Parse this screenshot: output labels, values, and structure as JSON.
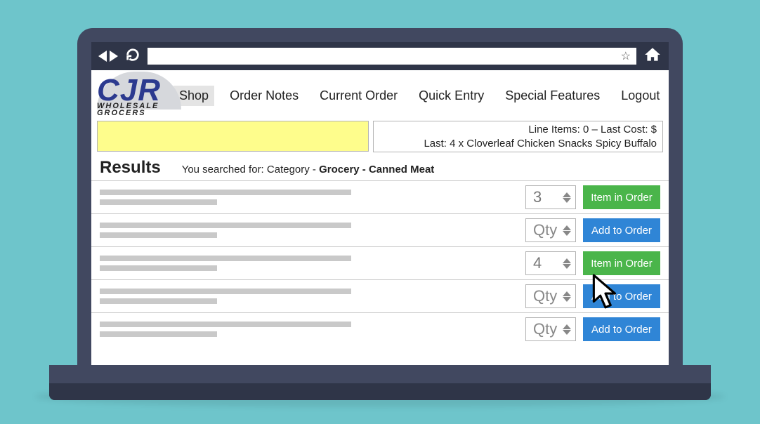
{
  "logo": {
    "name": "CJR",
    "tagline": "WHOLESALE GROCERS"
  },
  "nav": {
    "items": [
      "Shop",
      "Order Notes",
      "Current Order",
      "Quick Entry",
      "Special Features",
      "Logout"
    ],
    "active_index": 0
  },
  "status": {
    "line1": "Line Items: 0 – Last Cost: $",
    "line2": "Last: 4 x  Cloverleaf Chicken Snacks Spicy Buffalo"
  },
  "results": {
    "title": "Results",
    "search_prefix": "You searched for: Category - ",
    "search_bold": "Grocery - Canned Meat"
  },
  "qty_placeholder": "Qty",
  "buttons": {
    "in_order": "Item in Order",
    "add": "Add to Order"
  },
  "rows": [
    {
      "qty": "3",
      "in_order": true
    },
    {
      "qty": "",
      "in_order": false
    },
    {
      "qty": "4",
      "in_order": true
    },
    {
      "qty": "",
      "in_order": false
    },
    {
      "qty": "",
      "in_order": false
    }
  ]
}
